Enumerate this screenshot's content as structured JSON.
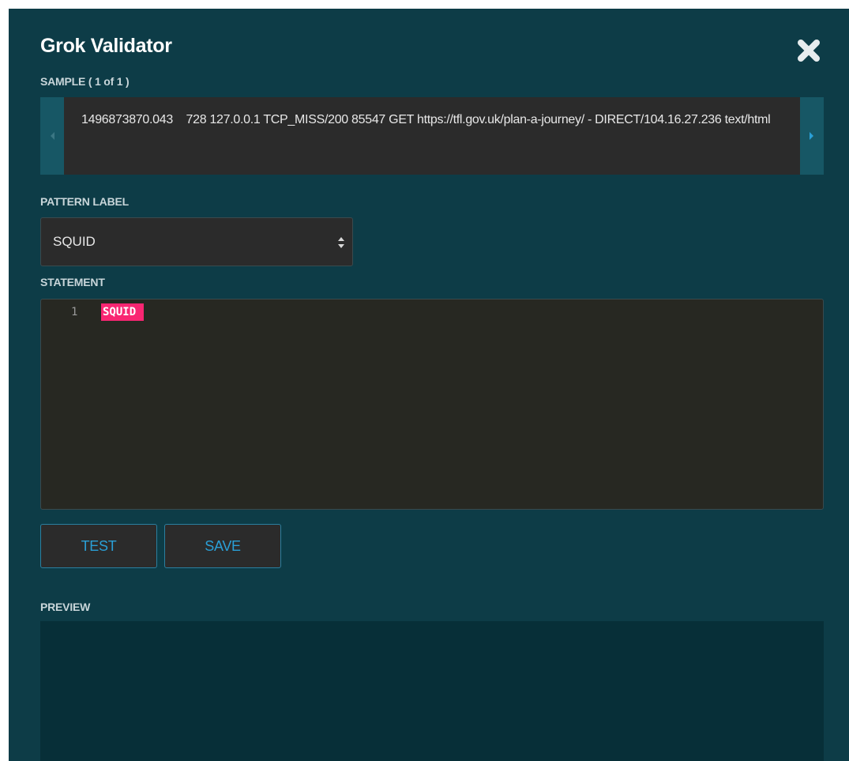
{
  "dialog": {
    "title": "Grok Validator",
    "close_icon": "close-icon"
  },
  "sample": {
    "label": "SAMPLE ( 1 of 1 )",
    "text": "1496873870.043    728 127.0.0.1 TCP_MISS/200 85547 GET https://tfl.gov.uk/plan-a-journey/ - DIRECT/104.16.27.236 text/html",
    "prev_icon": "chevron-left-icon",
    "next_icon": "chevron-right-icon"
  },
  "pattern_label": {
    "label": "PATTERN LABEL",
    "selected": "SQUID",
    "arrows_icon": "select-arrows-icon"
  },
  "statement": {
    "label": "STATEMENT",
    "line_number": "1",
    "code": "SQUID"
  },
  "actions": {
    "test_label": "TEST",
    "save_label": "SAVE"
  },
  "preview": {
    "label": "PREVIEW"
  },
  "colors": {
    "panel_bg": "#0d3c47",
    "accent": "#2a9fd6",
    "token_highlight": "#f92672",
    "editor_bg": "#272822"
  }
}
